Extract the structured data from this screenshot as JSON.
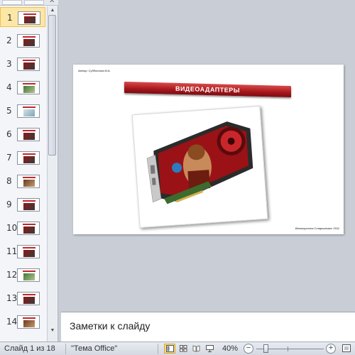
{
  "thumbnails": [
    {
      "num": "1",
      "pic": "dark",
      "active": true
    },
    {
      "num": "2",
      "pic": "dark"
    },
    {
      "num": "3",
      "pic": "dark"
    },
    {
      "num": "4",
      "pic": "green"
    },
    {
      "num": "5",
      "pic": "light"
    },
    {
      "num": "6",
      "pic": "dark"
    },
    {
      "num": "7",
      "pic": "dark"
    },
    {
      "num": "8",
      "pic": "brown"
    },
    {
      "num": "9",
      "pic": "dark"
    },
    {
      "num": "10",
      "pic": "dark"
    },
    {
      "num": "11",
      "pic": "dark"
    },
    {
      "num": "12",
      "pic": "green"
    },
    {
      "num": "13",
      "pic": "dark"
    },
    {
      "num": "14",
      "pic": "brown"
    }
  ],
  "slide": {
    "author": "Автор: Субботина М.А.",
    "title": "ВИДЕОАДАПТЕРЫ",
    "footer": "Великоустюг Староальянс 2011",
    "photo_alt": "graphics-card-photo"
  },
  "notes": {
    "placeholder": "Заметки к слайду"
  },
  "status": {
    "slide_counter": "Слайд 1 из 18",
    "theme": "\"Тема Office\"",
    "zoom": "40%",
    "zoom_out": "−",
    "zoom_in": "+"
  },
  "colors": {
    "banner": "#a6161c",
    "active_thumb": "#fce7a6",
    "status_bg": "#dde2e8"
  }
}
